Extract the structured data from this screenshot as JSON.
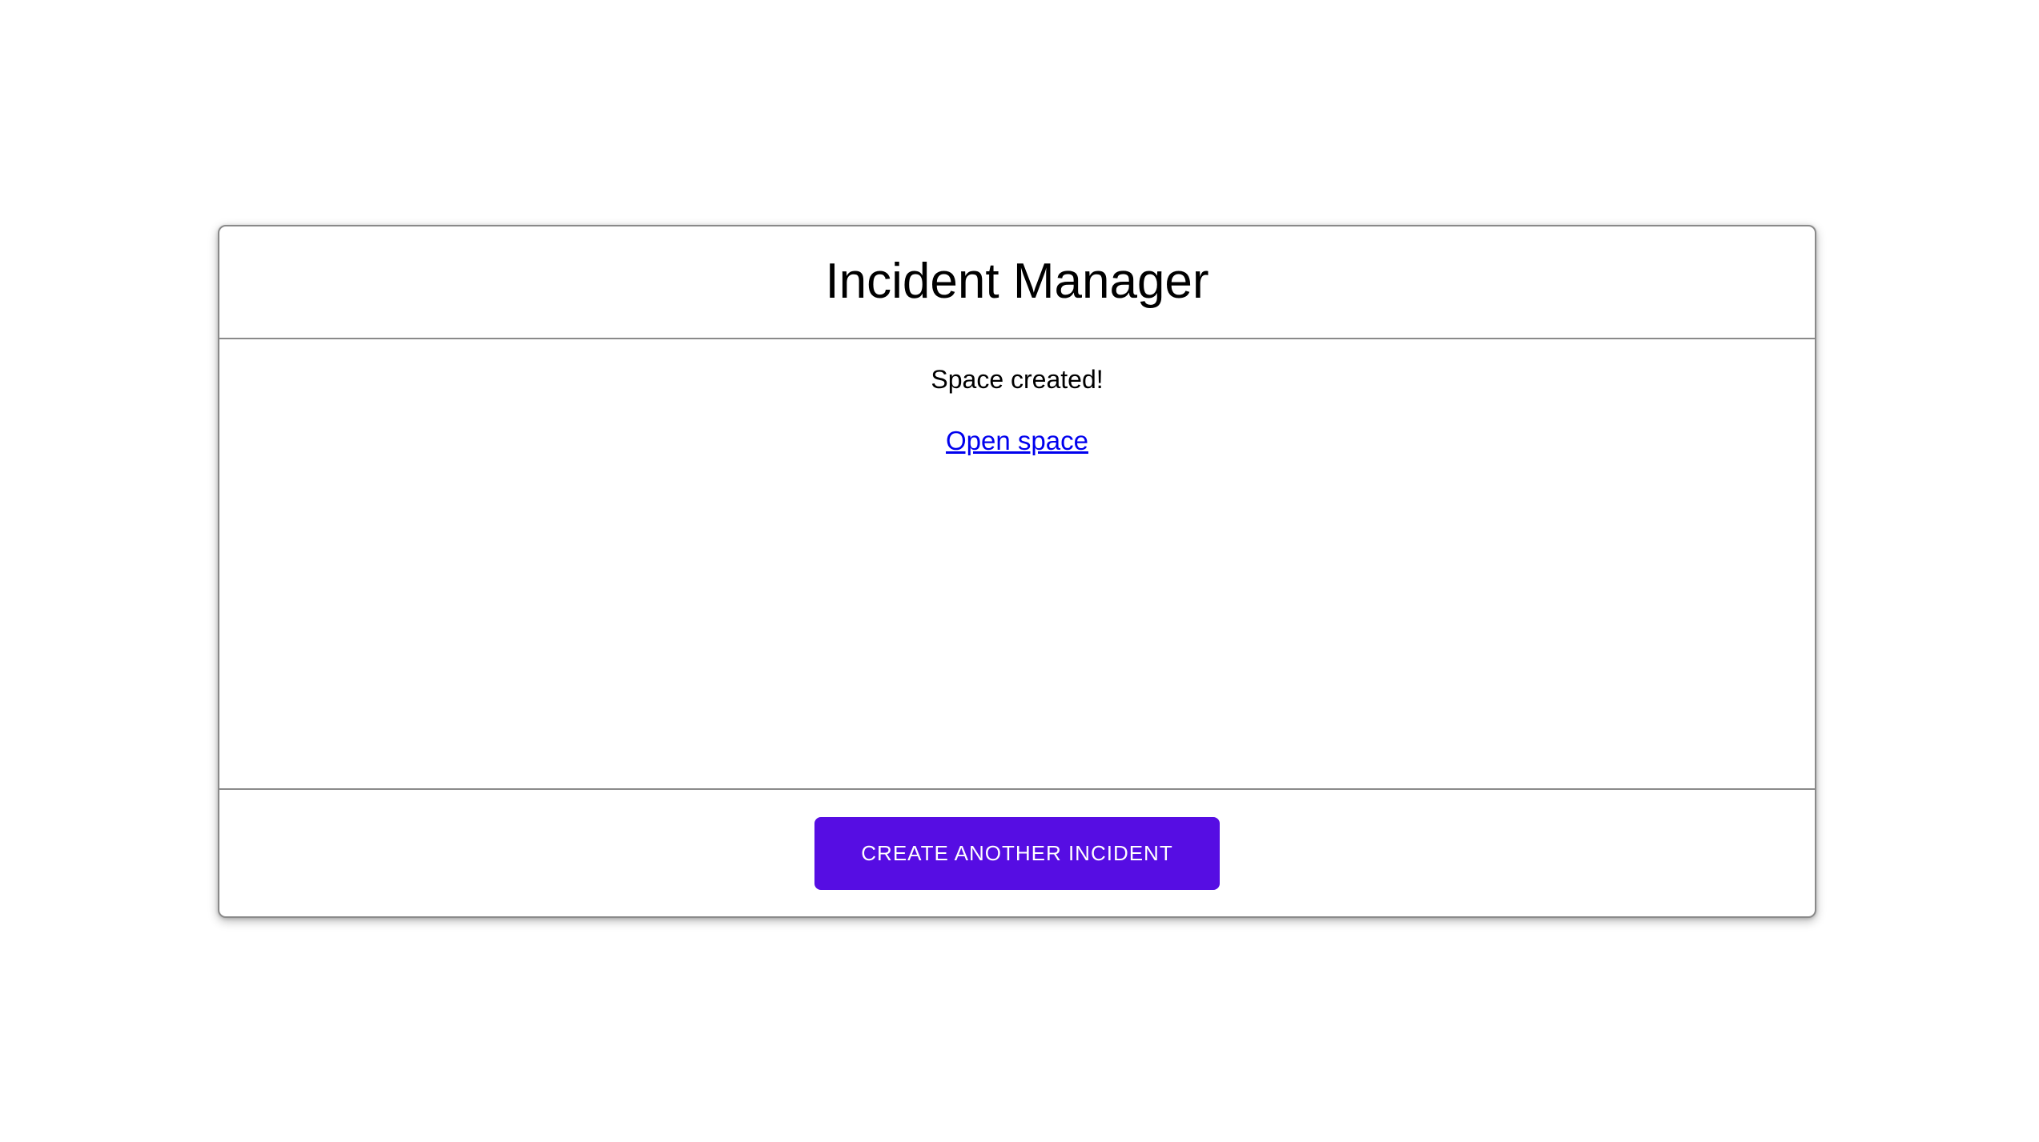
{
  "app": {
    "title": "Incident Manager"
  },
  "result": {
    "message": "Space created!",
    "link_label": "Open space"
  },
  "footer": {
    "create_button_label": "CREATE ANOTHER INCIDENT"
  },
  "colors": {
    "primary": "#560de3",
    "link": "#0000ee",
    "border": "#8a8a8a",
    "text": "#000000"
  }
}
